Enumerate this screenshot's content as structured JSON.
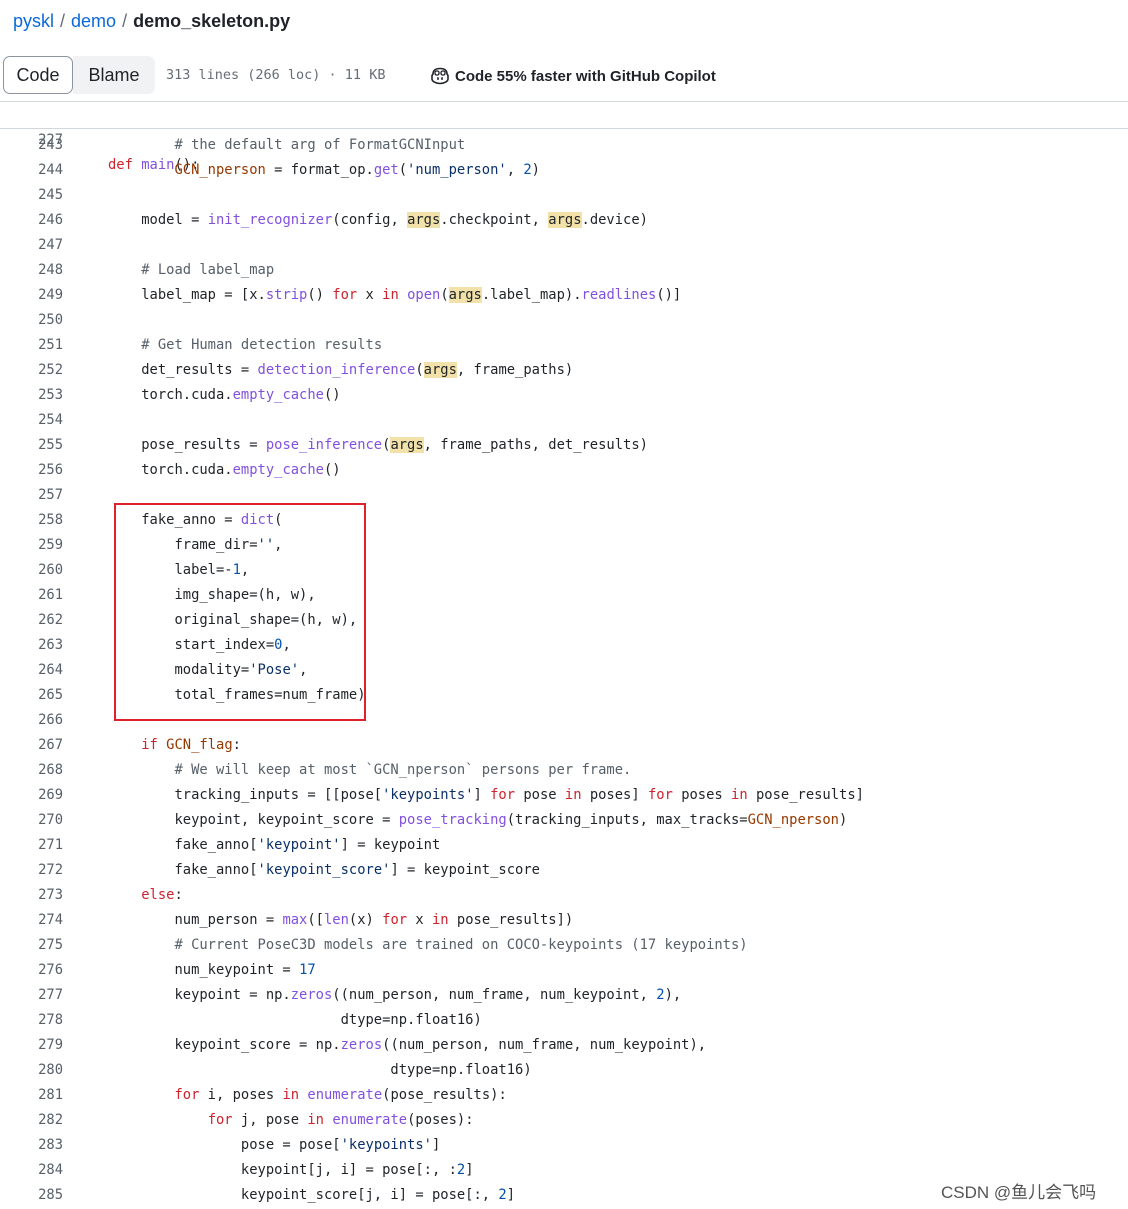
{
  "breadcrumb": {
    "repo": "pyskl",
    "sep": "/",
    "folder": "demo",
    "file": "demo_skeleton.py"
  },
  "toolbar": {
    "code_tab": "Code",
    "blame_tab": "Blame",
    "file_info": "313 lines (266 loc) · 11 KB",
    "copilot_text": "Code 55% faster with GitHub Copilot"
  },
  "sticky": {
    "line_no": "227",
    "line": "def main():"
  },
  "code_lines": [
    {
      "n": "243",
      "t": "        # the default arg of FormatGCNInput"
    },
    {
      "n": "244",
      "t": "        GCN_nperson = format_op.get('num_person', 2)"
    },
    {
      "n": "245",
      "t": ""
    },
    {
      "n": "246",
      "t": "    model = init_recognizer(config, args.checkpoint, args.device)"
    },
    {
      "n": "247",
      "t": ""
    },
    {
      "n": "248",
      "t": "    # Load label_map"
    },
    {
      "n": "249",
      "t": "    label_map = [x.strip() for x in open(args.label_map).readlines()]"
    },
    {
      "n": "250",
      "t": ""
    },
    {
      "n": "251",
      "t": "    # Get Human detection results"
    },
    {
      "n": "252",
      "t": "    det_results = detection_inference(args, frame_paths)"
    },
    {
      "n": "253",
      "t": "    torch.cuda.empty_cache()"
    },
    {
      "n": "254",
      "t": ""
    },
    {
      "n": "255",
      "t": "    pose_results = pose_inference(args, frame_paths, det_results)"
    },
    {
      "n": "256",
      "t": "    torch.cuda.empty_cache()"
    },
    {
      "n": "257",
      "t": ""
    },
    {
      "n": "258",
      "t": "    fake_anno = dict("
    },
    {
      "n": "259",
      "t": "        frame_dir='',"
    },
    {
      "n": "260",
      "t": "        label=-1,"
    },
    {
      "n": "261",
      "t": "        img_shape=(h, w),"
    },
    {
      "n": "262",
      "t": "        original_shape=(h, w),"
    },
    {
      "n": "263",
      "t": "        start_index=0,"
    },
    {
      "n": "264",
      "t": "        modality='Pose',"
    },
    {
      "n": "265",
      "t": "        total_frames=num_frame)"
    },
    {
      "n": "266",
      "t": ""
    },
    {
      "n": "267",
      "t": "    if GCN_flag:"
    },
    {
      "n": "268",
      "t": "        # We will keep at most `GCN_nperson` persons per frame."
    },
    {
      "n": "269",
      "t": "        tracking_inputs = [[pose['keypoints'] for pose in poses] for poses in pose_results]"
    },
    {
      "n": "270",
      "t": "        keypoint, keypoint_score = pose_tracking(tracking_inputs, max_tracks=GCN_nperson)"
    },
    {
      "n": "271",
      "t": "        fake_anno['keypoint'] = keypoint"
    },
    {
      "n": "272",
      "t": "        fake_anno['keypoint_score'] = keypoint_score"
    },
    {
      "n": "273",
      "t": "    else:"
    },
    {
      "n": "274",
      "t": "        num_person = max([len(x) for x in pose_results])"
    },
    {
      "n": "275",
      "t": "        # Current PoseC3D models are trained on COCO-keypoints (17 keypoints)"
    },
    {
      "n": "276",
      "t": "        num_keypoint = 17"
    },
    {
      "n": "277",
      "t": "        keypoint = np.zeros((num_person, num_frame, num_keypoint, 2),"
    },
    {
      "n": "278",
      "t": "                            dtype=np.float16)"
    },
    {
      "n": "279",
      "t": "        keypoint_score = np.zeros((num_person, num_frame, num_keypoint),"
    },
    {
      "n": "280",
      "t": "                                  dtype=np.float16)"
    },
    {
      "n": "281",
      "t": "        for i, poses in enumerate(pose_results):"
    },
    {
      "n": "282",
      "t": "            for j, pose in enumerate(poses):"
    },
    {
      "n": "283",
      "t": "                pose = pose['keypoints']"
    },
    {
      "n": "284",
      "t": "                keypoint[j, i] = pose[:, :2]"
    },
    {
      "n": "285",
      "t": "                keypoint_score[j, i] = pose[:, 2]"
    }
  ],
  "watermark": "CSDN @鱼儿会飞吗",
  "colors": {
    "link": "#0969da",
    "keyword": "#cf222e",
    "function": "#8250df",
    "string": "#0a3069",
    "comment": "#57606a",
    "number": "#0550ae",
    "args_highlight": "#f2e1a8",
    "annotation_box": "#e0202a"
  }
}
